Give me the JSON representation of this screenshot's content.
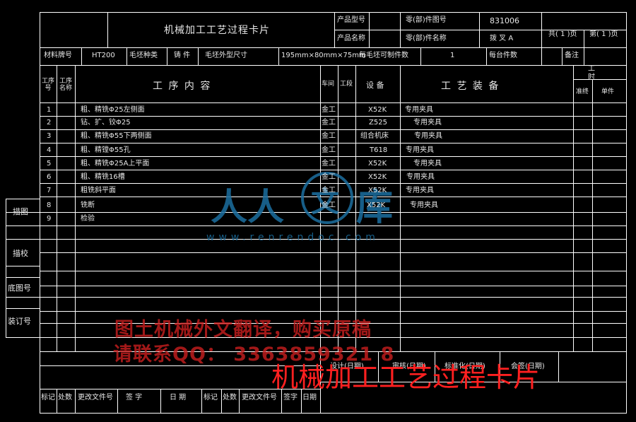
{
  "header": {
    "title": "机械加工工艺过程卡片",
    "product_model_label": "产品型号",
    "product_name_label": "产品名称",
    "part_number_label": "零(部)件图号",
    "part_number_value": "831006",
    "part_name_label": "零(部)件名称",
    "part_name_value": "拨 叉 A",
    "sheet_total": "共( 1 )页",
    "sheet_no": "第( 1 )页"
  },
  "spec_row": {
    "material_label": "材料牌号",
    "material_value": "HT200",
    "blank_type_label": "毛坯种类",
    "blank_type_value": "铸 件",
    "blank_size_label": "毛坯外型尺寸",
    "blank_size_value": "195mm×80mm×75mm",
    "per_blank_label": "每毛坯可制件数",
    "per_blank_value": "1",
    "per_unit_label": "每台件数",
    "remarks_label": "备注"
  },
  "table": {
    "head": {
      "step_no": "工序号",
      "step_name": "工序名称",
      "content": "工   序   内   容",
      "workshop": "车间",
      "section": "工段",
      "equipment": "设 备",
      "tooling": "工   艺   装   备",
      "hours": "工时",
      "prep": "准终",
      "unit": "单件"
    },
    "rows": [
      {
        "no": "1",
        "content": "粗、精铣Φ25左侧面",
        "workshop": "金工",
        "equipment": "X52K",
        "tooling": "专用夹具"
      },
      {
        "no": "2",
        "content": "钻、扩、铰Φ25",
        "workshop": "金工",
        "equipment": "Z525",
        "tooling": "专用夹具"
      },
      {
        "no": "3",
        "content": "粗、精铣Φ55下两侧面",
        "workshop": "金工",
        "equipment": "组合机床",
        "tooling": "专用夹具"
      },
      {
        "no": "4",
        "content": "粗、精镗Φ55孔",
        "workshop": "金工",
        "equipment": "T618",
        "tooling": "专用夹具"
      },
      {
        "no": "5",
        "content": "粗、精铣Φ25A上平面",
        "workshop": "金工",
        "equipment": "X52K",
        "tooling": "专用夹具"
      },
      {
        "no": "6",
        "content": "粗、精铣16槽",
        "workshop": "金工",
        "equipment": "X52K",
        "tooling": "专用夹具"
      },
      {
        "no": "7",
        "content": "粗铣斜平面",
        "workshop": "金工",
        "equipment": "X52K",
        "tooling": "专用夹具"
      },
      {
        "no": "8",
        "content": "铣断",
        "workshop": "金工",
        "equipment": "X52K",
        "tooling": "专用夹具"
      },
      {
        "no": "9",
        "content": "检验",
        "workshop": "",
        "equipment": "",
        "tooling": ""
      }
    ]
  },
  "side_labels": {
    "draw": "描图",
    "check": "描校",
    "base_no": "底图号",
    "bind_no": "装订号"
  },
  "approval": {
    "design": "设计(日期)",
    "review": "审核(日期)",
    "standard": "标准化(日期)",
    "sign": "会签(日期)"
  },
  "footer": {
    "mark": "标记",
    "count": "处数",
    "change_doc": "更改文件号",
    "signature": "签  字",
    "date": "日  期",
    "mark2": "标记",
    "count2": "处数",
    "change_doc2": "更改文件号",
    "signature2": "签字",
    "date2": "日期"
  },
  "watermarks": {
    "site_url": "www.renrendoc.com",
    "ad_line1": "图土机械外文翻译，购买原稿",
    "ad_line2": "请联系QQ： 3363859321 8",
    "stamp_title": "机械加工工艺过程卡片"
  },
  "colors": {
    "background": "#000000",
    "line": "#ffffff",
    "text": "#e6e6e6",
    "watermark_red": "#cf1f1f",
    "stamp_red": "#ff2020",
    "logo_blue": "#1c6fa0"
  }
}
